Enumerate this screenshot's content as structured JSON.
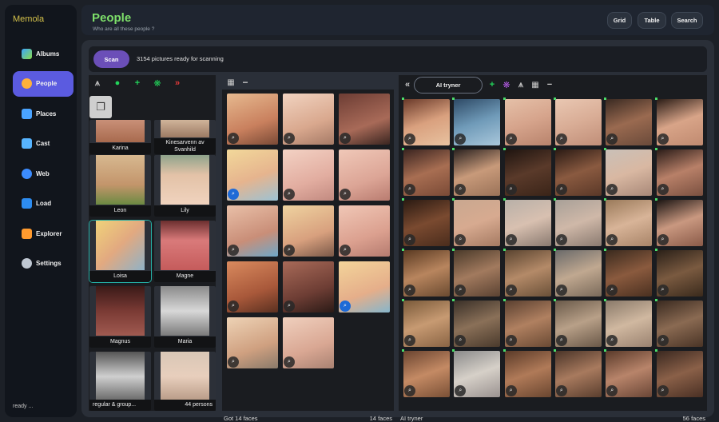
{
  "app": {
    "brand": "Memola",
    "status": "ready ..."
  },
  "nav": [
    {
      "label": "Albums",
      "icon": "albums-icon",
      "color": "#3aa6ff"
    },
    {
      "label": "People",
      "icon": "face-icon",
      "color": "#ffb13b"
    },
    {
      "label": "Places",
      "icon": "map-icon",
      "color": "#4aa3ff"
    },
    {
      "label": "Cast",
      "icon": "cast-icon",
      "color": "#57b4ff"
    },
    {
      "label": "Web",
      "icon": "globe-icon",
      "color": "#3c8cff"
    },
    {
      "label": "Load",
      "icon": "load-icon",
      "color": "#2d8cf0"
    },
    {
      "label": "Explorer",
      "icon": "explorer-icon",
      "color": "#ff9a2e"
    },
    {
      "label": "Settings",
      "icon": "gear-icon",
      "color": "#bfc7d2"
    }
  ],
  "header": {
    "title": "People",
    "subtitle": "Who are all these people ?",
    "buttons": [
      "Grid",
      "Table",
      "Search"
    ]
  },
  "scan": {
    "button": "Scan",
    "status": "3154 pictures ready for scanning"
  },
  "people": {
    "names": [
      "Karina",
      "Kinesarvenn av Svanhild",
      "Leon",
      "Lily",
      "Loisa",
      "Magne",
      "Magnus",
      "Maria",
      "regular & group...",
      ""
    ],
    "selected": "Loisa",
    "footer_count": "44 persons"
  },
  "faces_panel": {
    "footer_left": "Got 14 faces",
    "footer_right": "14 faces",
    "count": 14
  },
  "ai_panel": {
    "search_value": "AI tryner",
    "footer_left": "AI tryner",
    "footer_right": "56 faces",
    "count": 36
  },
  "colors": {
    "accent": "#5b5be0",
    "scan": "#6b4fb8",
    "title": "#7ee06a",
    "selection": "#25b0a6"
  }
}
